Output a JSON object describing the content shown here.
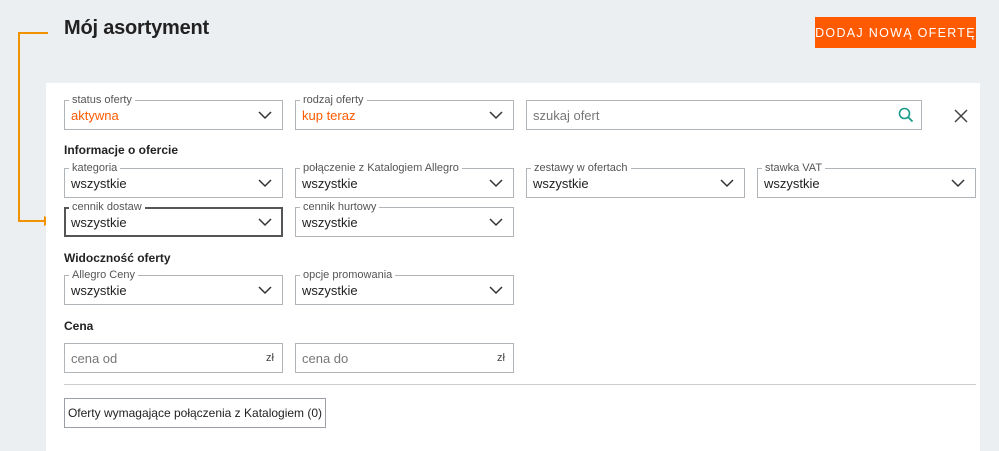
{
  "header": {
    "title": "Mój asortyment",
    "add_offer_label": "DODAJ NOWĄ OFERTĘ"
  },
  "filters": {
    "status": {
      "legend": "status oferty",
      "value": "aktywna"
    },
    "type": {
      "legend": "rodzaj oferty",
      "value": "kup teraz"
    },
    "search": {
      "placeholder": "szukaj ofert"
    }
  },
  "offer_info": {
    "title": "Informacje o ofercie",
    "category": {
      "legend": "kategoria",
      "value": "wszystkie"
    },
    "catalog_link": {
      "legend": "połączenie z Katalogiem Allegro",
      "value": "wszystkie"
    },
    "bundles": {
      "legend": "zestawy w ofertach",
      "value": "wszystkie"
    },
    "vat": {
      "legend": "stawka VAT",
      "value": "wszystkie"
    },
    "shipping": {
      "legend": "cennik dostaw",
      "value": "wszystkie"
    },
    "wholesale": {
      "legend": "cennik hurtowy",
      "value": "wszystkie"
    }
  },
  "visibility": {
    "title": "Widoczność oferty",
    "allegro_prices": {
      "legend": "Allegro Ceny",
      "value": "wszystkie"
    },
    "promotion": {
      "legend": "opcje promowania",
      "value": "wszystkie"
    }
  },
  "price": {
    "title": "Cena",
    "from": {
      "placeholder": "cena od",
      "suffix": "zł"
    },
    "to": {
      "placeholder": "cena do",
      "suffix": "zł"
    }
  },
  "catalog_button_label": "Oferty wymagające połączenia z Katalogiem (0)",
  "colors": {
    "accent": "#ff5a00",
    "annotation": "#f39200"
  }
}
